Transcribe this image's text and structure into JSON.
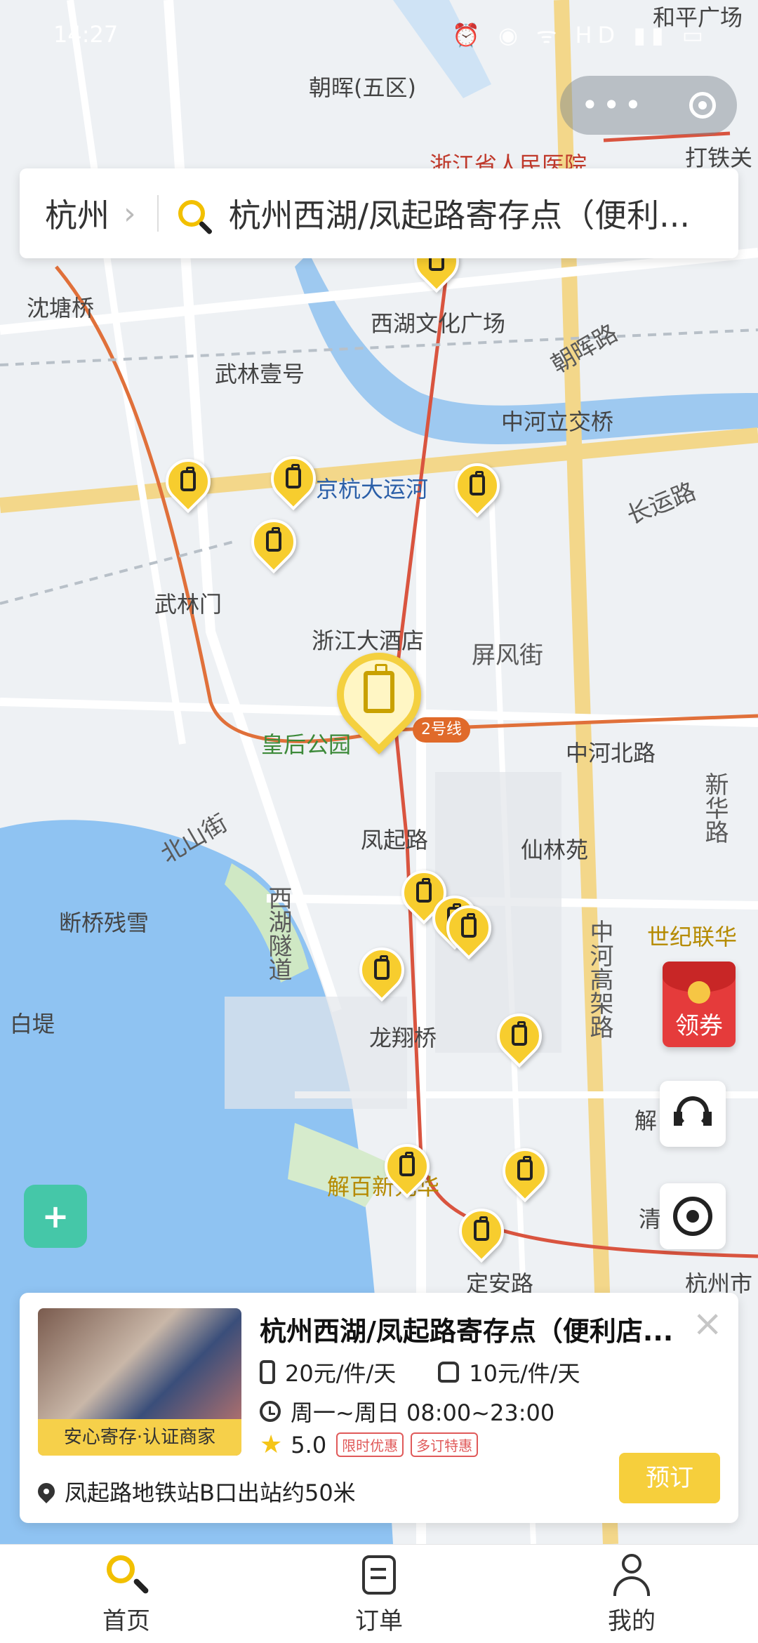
{
  "status_bar": {
    "time": "14:27",
    "icons": "⏰ ◉ ᯤ HD ▮▮ ▭"
  },
  "search": {
    "city": "杭州",
    "query": "杭州西湖/凤起路寄存点（便利..."
  },
  "map": {
    "labels": {
      "zhaohui": "朝晖(五区)",
      "heping": "和平广场",
      "hospital": "浙江省人民医院",
      "datieguan": "打铁关",
      "shentangqiao": "沈塘桥",
      "culture_square": "西湖文化广场",
      "zhaohui_road": "朝晖路",
      "wulin_yihao": "武林壹号",
      "zhonghe_bridge": "中河立交桥",
      "grand_canal": "京杭大运河",
      "changyun_road": "长运路",
      "wulinmen": "武林门",
      "zhejiang_hotel": "浙江大酒店",
      "pingfeng_street": "屏风街",
      "queen_park": "皇后公园",
      "line2": "2号线",
      "zhonghe_north": "中河北路",
      "xinhua_road": "新华路",
      "fengqi_road": "凤起路",
      "xianlin_yuan": "仙林苑",
      "beishan_street": "北山街",
      "xihu_tunnel": "西湖隧道",
      "duanqiao": "断桥残雪",
      "century_lianhua": "世纪联华",
      "zhonghe_elevated": "中河高架路",
      "baidi": "白堤",
      "longxiang_bridge": "龙翔桥",
      "jiebai": "解百新元华",
      "dingan_road": "定安路",
      "hz_city": "杭州市",
      "jie": "解",
      "qing": "清"
    }
  },
  "coupon": {
    "label": "领券"
  },
  "card": {
    "title": "杭州西湖/凤起路寄存点（便利店...",
    "badge": "安心寄存·认证商家",
    "price_large": "20元/件/天",
    "price_small": "10元/件/天",
    "hours": "周一~周日 08:00~23:00",
    "rating": "5.0",
    "tag1": "限时优惠",
    "tag2": "多订特惠",
    "address": "凤起路地铁站B口出站约50米",
    "book_label": "预订"
  },
  "tabs": [
    {
      "label": "首页"
    },
    {
      "label": "订单"
    },
    {
      "label": "我的"
    }
  ]
}
